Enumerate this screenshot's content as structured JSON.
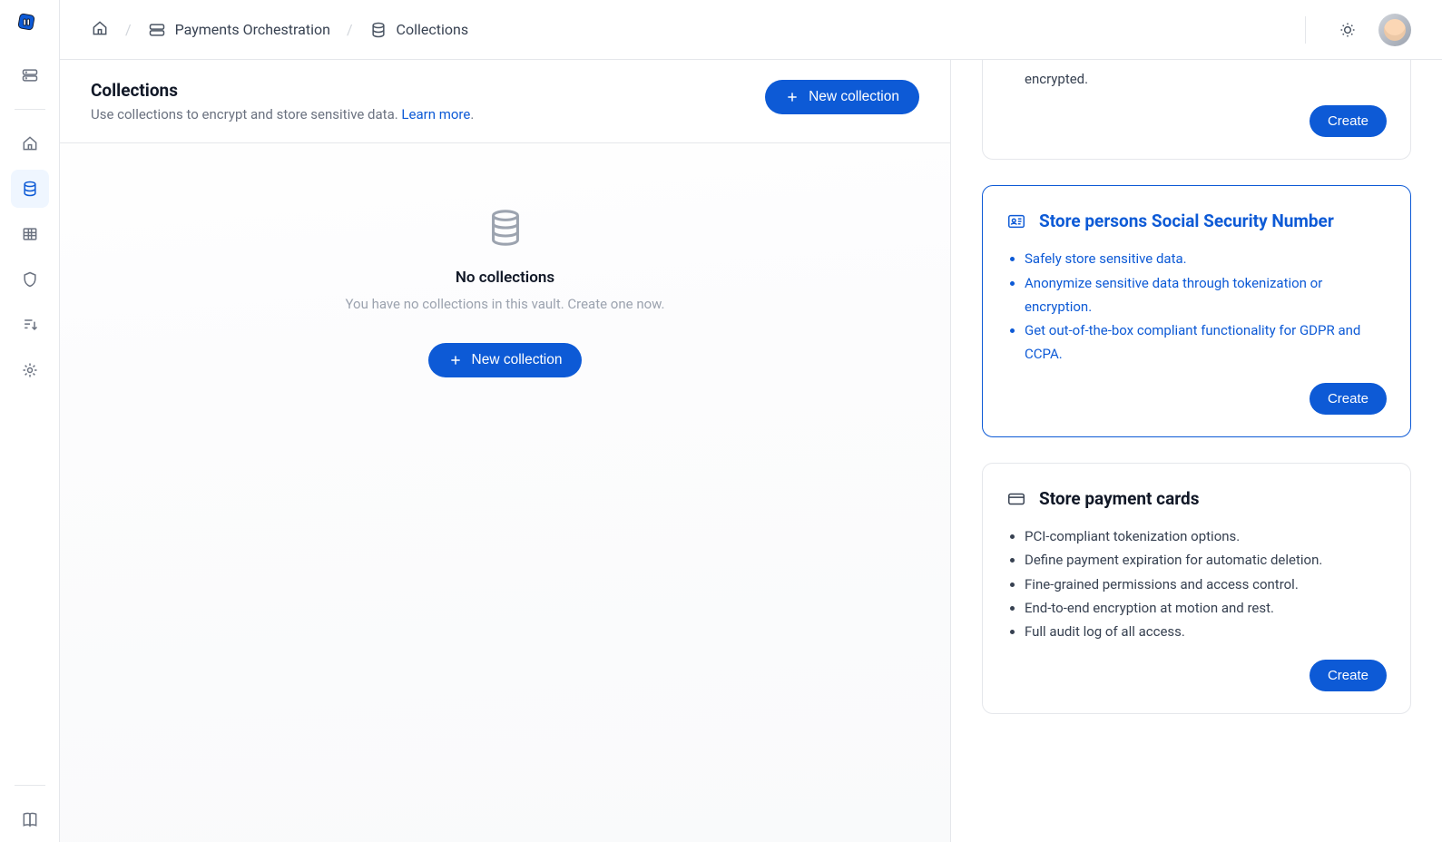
{
  "breadcrumbs": {
    "item1": "Payments Orchestration",
    "item2": "Collections"
  },
  "page": {
    "title": "Collections",
    "subtitle": "Use collections to encrypt and store sensitive data. ",
    "learn_more": "Learn more",
    "new_collection": "New collection"
  },
  "empty": {
    "title": "No collections",
    "desc": "You have no collections in this vault. Create one now.",
    "button": "New collection"
  },
  "cards": {
    "partial": {
      "fragment": "encrypted.",
      "create": "Create"
    },
    "ssn": {
      "title": "Store persons Social Security Number",
      "b1": "Safely store sensitive data.",
      "b2": "Anonymize sensitive data through tokenization or encryption.",
      "b3": "Get out-of-the-box compliant functionality for GDPR and CCPA.",
      "create": "Create"
    },
    "payment": {
      "title": "Store payment cards",
      "b1": "PCI-compliant tokenization options.",
      "b2": "Define payment expiration for automatic deletion.",
      "b3": "Fine-grained permissions and access control.",
      "b4": "End-to-end encryption at motion and rest.",
      "b5": "Full audit log of all access.",
      "create": "Create"
    }
  }
}
